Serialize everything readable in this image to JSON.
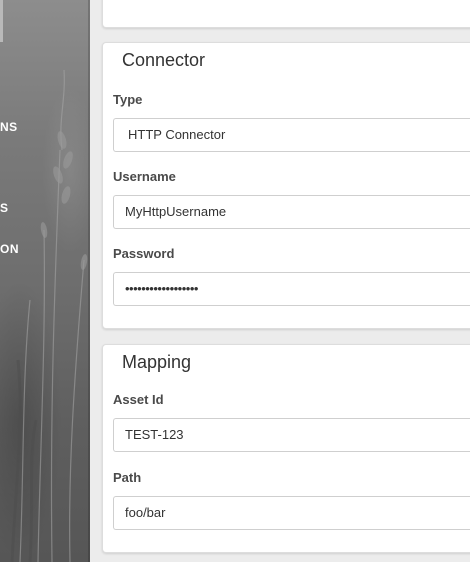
{
  "sidebar": {
    "items": [
      {
        "label": "NS"
      },
      {
        "label": "S"
      },
      {
        "label": "ON"
      }
    ]
  },
  "connector": {
    "title": "Connector",
    "type_label": "Type",
    "type_value": "HTTP Connector",
    "username_label": "Username",
    "username_value": "MyHttpUsername",
    "password_label": "Password",
    "password_value": "••••••••••••••••••"
  },
  "mapping": {
    "title": "Mapping",
    "asset_id_label": "Asset Id",
    "asset_id_value": "TEST-123",
    "path_label": "Path",
    "path_value": "foo/bar"
  }
}
